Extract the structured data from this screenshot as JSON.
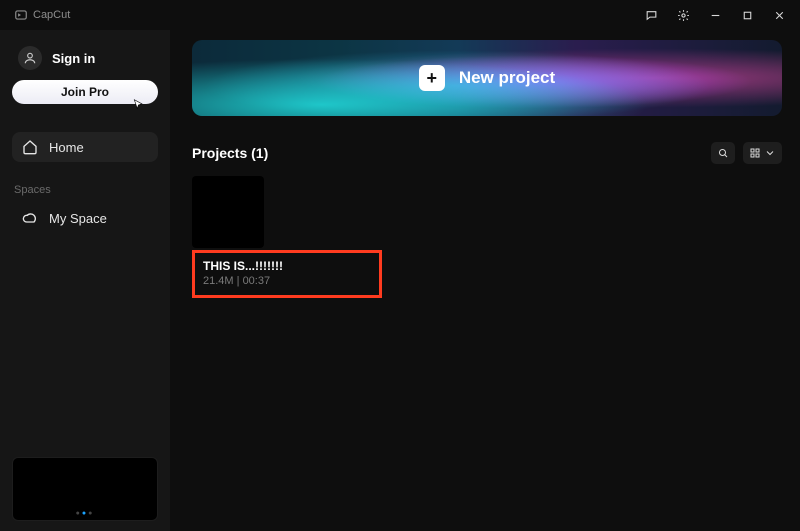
{
  "brand": "CapCut",
  "window": {
    "feedback_icon": "chat-icon",
    "settings_icon": "gear-icon"
  },
  "sidebar": {
    "signin_label": "Sign in",
    "joinpro_label": "Join Pro",
    "home_label": "Home",
    "spaces_heading": "Spaces",
    "myspace_label": "My Space"
  },
  "hero": {
    "label": "New project"
  },
  "projects": {
    "heading": "Projects  (1)",
    "item": {
      "name": "THIS IS...!!!!!!!",
      "size": "21.4M",
      "duration": "00:37"
    }
  }
}
